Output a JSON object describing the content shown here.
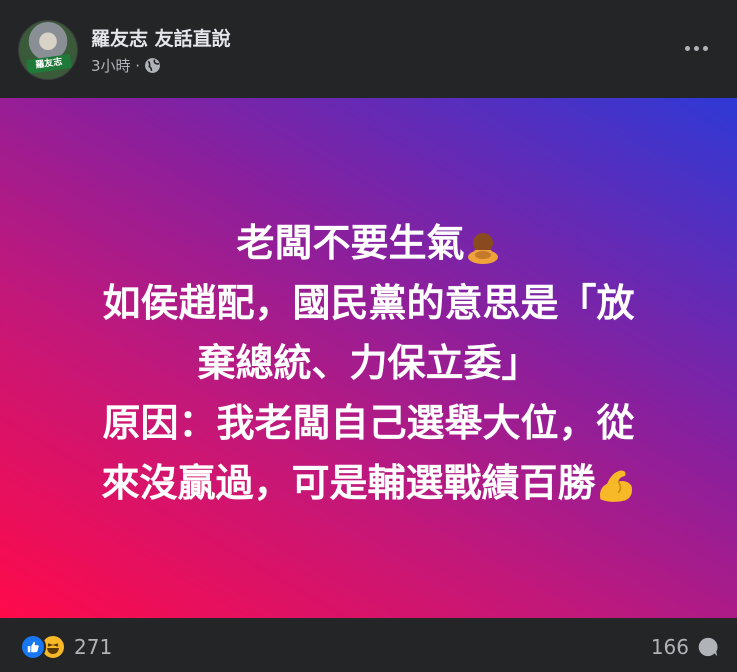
{
  "post": {
    "author": "羅友志 友話直說",
    "time": "3小時 ·",
    "content_lines": [
      "老闆不要生氣",
      "如侯趙配，國民黨的意思是「放",
      "棄總統、力保立委」",
      "原因：我老闆自己選舉大位，從",
      "來沒贏過，可是輔選戰績百勝"
    ],
    "emojis": [
      "person-bowing-emoji",
      "flexed-biceps-emoji"
    ],
    "reaction_count": "271",
    "comment_count": "166"
  },
  "icons": {
    "audience": "globe-icon",
    "more": "more-options-icon",
    "like": "like-icon",
    "haha": "haha-icon",
    "comment": "comment-icon"
  },
  "colors": {
    "background": "#242526",
    "text_primary": "#e4e6eb",
    "text_secondary": "#b0b3b8",
    "like_blue": "#1877f2",
    "gradient_start": "#ff0a4a",
    "gradient_end": "#2f39d6"
  }
}
